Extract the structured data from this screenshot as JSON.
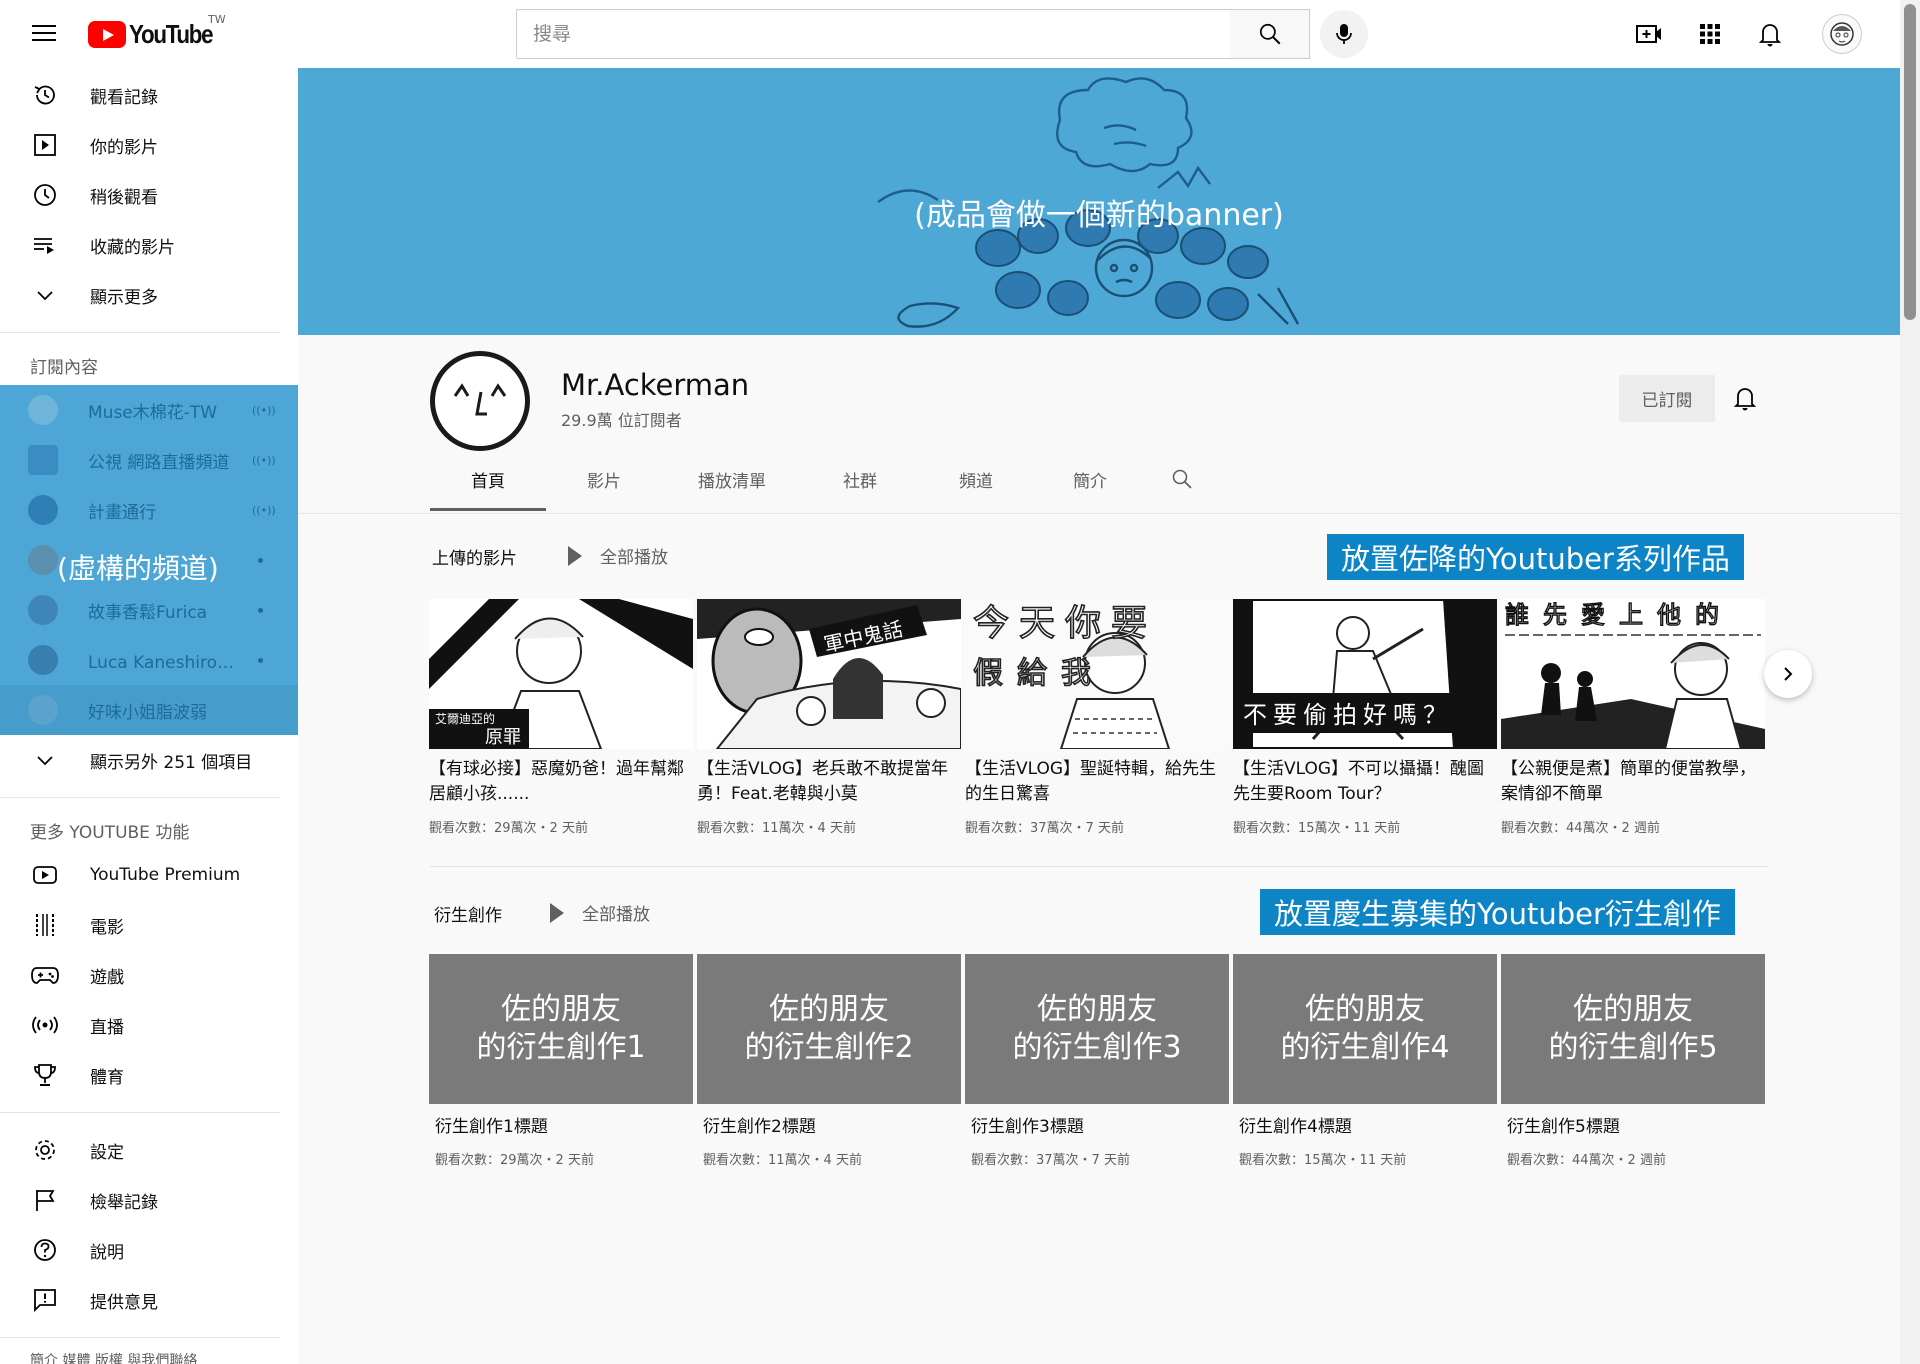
{
  "header": {
    "logo_text": "YouTube",
    "region": "TW",
    "search_placeholder": "搜尋"
  },
  "sidebar": {
    "primary": [
      {
        "label": "觀看記錄",
        "icon": "history-icon"
      },
      {
        "label": "你的影片",
        "icon": "your-videos-icon"
      },
      {
        "label": "稍後觀看",
        "icon": "watch-later-icon"
      },
      {
        "label": "收藏的影片",
        "icon": "playlist-icon"
      },
      {
        "label": "顯示更多",
        "icon": "chevron-down-icon"
      }
    ],
    "subscriptions_title": "訂閱內容",
    "subscriptions": [
      {
        "label": "Muse木棉花-TW",
        "indicator": "live"
      },
      {
        "label": "公視 網路直播頻道",
        "indicator": "live"
      },
      {
        "label": "計畫通行",
        "indicator": "live"
      },
      {
        "label": "",
        "indicator": "new"
      },
      {
        "label": "故事香鬆Furica",
        "indicator": "new"
      },
      {
        "label": "Luca Kaneshiro【…",
        "indicator": "new"
      },
      {
        "label": "好味小姐脂波弱",
        "indicator": ""
      }
    ],
    "fake_channel_note": "(虛構的頻道)",
    "show_more_subs": "顯示另外 251 個項目",
    "more_title": "更多 YOUTUBE 功能",
    "more": [
      {
        "label": "YouTube Premium",
        "icon": "youtube-premium-icon"
      },
      {
        "label": "電影",
        "icon": "movies-icon"
      },
      {
        "label": "遊戲",
        "icon": "gaming-icon"
      },
      {
        "label": "直播",
        "icon": "live-icon"
      },
      {
        "label": "體育",
        "icon": "trophy-icon"
      }
    ],
    "settings": [
      {
        "label": "設定",
        "icon": "gear-icon"
      },
      {
        "label": "檢舉記錄",
        "icon": "flag-icon"
      },
      {
        "label": "說明",
        "icon": "help-icon"
      },
      {
        "label": "提供意見",
        "icon": "feedback-icon"
      }
    ],
    "footer": "簡介 媒體 版權 與我們聯絡"
  },
  "banner": {
    "note": "(成品會做一個新的banner)"
  },
  "channel": {
    "name": "Mr.Ackerman",
    "subscribers": "29.9萬 位訂閱者",
    "subscribed_label": "已訂閱",
    "tabs": [
      "首頁",
      "影片",
      "播放清單",
      "社群",
      "頻道",
      "簡介"
    ]
  },
  "uploads": {
    "title": "上傳的影片",
    "play_all": "全部播放",
    "note": "放置佐降的Youtuber系列作品",
    "videos": [
      {
        "title": "【有球必接】惡魔奶爸！過年幫鄰居顧小孩......",
        "meta": "觀看次數：29萬次・2 天前",
        "thumb_text": [
          "艾爾迪亞的",
          "原罪"
        ]
      },
      {
        "title": "【生活VLOG】老兵敢不敢提當年勇！Feat.老韓與小莫",
        "meta": "觀看次數：11萬次・4 天前",
        "thumb_text": [
          "軍中鬼話"
        ]
      },
      {
        "title": "【生活VLOG】聖誕特輯，給先生的生日驚喜",
        "meta": "觀看次數：37萬次・7 天前",
        "thumb_text": [
          "今天你要",
          "假給我"
        ]
      },
      {
        "title": "【生活VLOG】不可以攝攝！醜圖先生要Room Tour？",
        "meta": "觀看次數：15萬次・11 天前",
        "thumb_text": [
          "不要偷拍好嗎？"
        ]
      },
      {
        "title": "【公親便是煮】簡單的便當教學，案情卻不簡單",
        "meta": "觀看次數：44萬次・2 週前",
        "thumb_text": [
          "誰先愛上他的"
        ]
      }
    ]
  },
  "derivatives": {
    "title": "衍生創作",
    "play_all": "全部播放",
    "note": "放置慶生募集的Youtuber衍生創作",
    "items": [
      {
        "thumb_line1": "佐的朋友",
        "thumb_line2": "的衍生創作1",
        "title": "衍生創作1標題",
        "meta": "觀看次數：29萬次・2 天前"
      },
      {
        "thumb_line1": "佐的朋友",
        "thumb_line2": "的衍生創作2",
        "title": "衍生創作2標題",
        "meta": "觀看次數：11萬次・4 天前"
      },
      {
        "thumb_line1": "佐的朋友",
        "thumb_line2": "的衍生創作3",
        "title": "衍生創作3標題",
        "meta": "觀看次數：37萬次・7 天前"
      },
      {
        "thumb_line1": "佐的朋友",
        "thumb_line2": "的衍生創作4",
        "title": "衍生創作4標題",
        "meta": "觀看次數：15萬次・11 天前"
      },
      {
        "thumb_line1": "佐的朋友",
        "thumb_line2": "的衍生創作5",
        "title": "衍生創作5標題",
        "meta": "觀看次數：44萬次・2 週前"
      }
    ]
  }
}
